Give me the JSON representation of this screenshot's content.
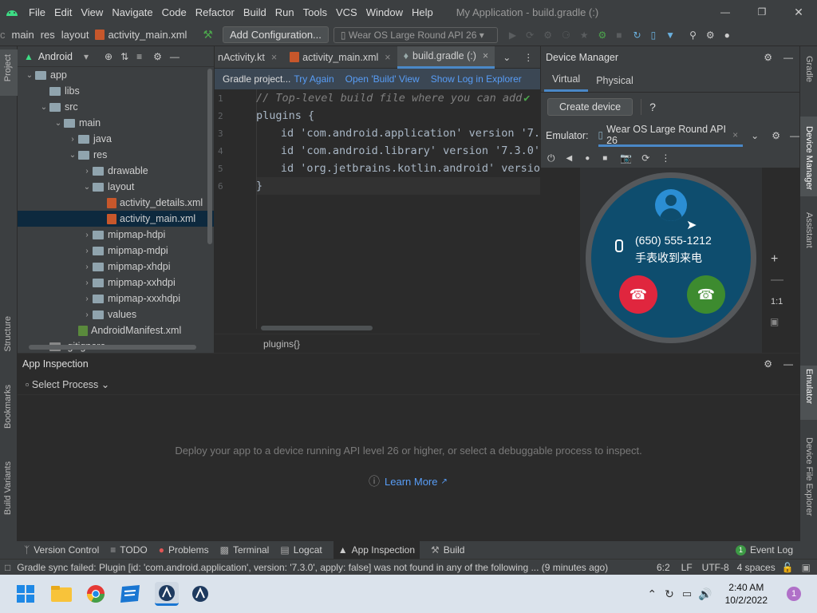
{
  "menubar": {
    "items": [
      "File",
      "Edit",
      "View",
      "Navigate",
      "Code",
      "Refactor",
      "Build",
      "Run",
      "Tools",
      "VCS",
      "Window",
      "Help"
    ],
    "title": "My Application - build.gradle (:)"
  },
  "navbar": {
    "breadcrumbs": [
      "main",
      "res",
      "layout",
      "activity_main.xml"
    ],
    "add_config": "Add Configuration...",
    "device": "Wear OS Large Round API 26"
  },
  "left_stripe": [
    "Project",
    "Structure",
    "Bookmarks",
    "Build Variants"
  ],
  "right_stripe": [
    "Gradle",
    "Device Manager",
    "Assistant",
    "Emulator",
    "Device File Explorer"
  ],
  "project": {
    "view": "Android",
    "tree": [
      {
        "label": "app",
        "depth": 0,
        "arrow": "v",
        "kind": "folder"
      },
      {
        "label": "libs",
        "depth": 1,
        "arrow": "",
        "kind": "folder"
      },
      {
        "label": "src",
        "depth": 1,
        "arrow": "v",
        "kind": "folder"
      },
      {
        "label": "main",
        "depth": 2,
        "arrow": "v",
        "kind": "folder"
      },
      {
        "label": "java",
        "depth": 3,
        "arrow": ">",
        "kind": "folder"
      },
      {
        "label": "res",
        "depth": 3,
        "arrow": "v",
        "kind": "folder"
      },
      {
        "label": "drawable",
        "depth": 4,
        "arrow": ">",
        "kind": "folder"
      },
      {
        "label": "layout",
        "depth": 4,
        "arrow": "v",
        "kind": "folder"
      },
      {
        "label": "activity_details.xml",
        "depth": 5,
        "arrow": "",
        "kind": "xml"
      },
      {
        "label": "activity_main.xml",
        "depth": 5,
        "arrow": "",
        "kind": "xml",
        "selected": true
      },
      {
        "label": "mipmap-hdpi",
        "depth": 4,
        "arrow": ">",
        "kind": "folder"
      },
      {
        "label": "mipmap-mdpi",
        "depth": 4,
        "arrow": ">",
        "kind": "folder"
      },
      {
        "label": "mipmap-xhdpi",
        "depth": 4,
        "arrow": ">",
        "kind": "folder"
      },
      {
        "label": "mipmap-xxhdpi",
        "depth": 4,
        "arrow": ">",
        "kind": "folder"
      },
      {
        "label": "mipmap-xxxhdpi",
        "depth": 4,
        "arrow": ">",
        "kind": "folder"
      },
      {
        "label": "values",
        "depth": 4,
        "arrow": ">",
        "kind": "folder"
      },
      {
        "label": "AndroidManifest.xml",
        "depth": 3,
        "arrow": "",
        "kind": "manifest"
      },
      {
        "label": ".gitignore",
        "depth": 1,
        "arrow": "",
        "kind": "file"
      }
    ]
  },
  "editor": {
    "tabs": [
      "nActivity.kt",
      "activity_main.xml",
      "build.gradle (:)"
    ],
    "gradle_bar": {
      "message": "Gradle project...",
      "try_again": "Try Again",
      "open_build": "Open 'Build' View",
      "show_log": "Show Log in Explorer"
    },
    "lines": [
      {
        "n": "1",
        "code": "// Top-level build file where you can add"
      },
      {
        "n": "2",
        "code": "plugins {"
      },
      {
        "n": "3",
        "code": "    id 'com.android.application' version '7."
      },
      {
        "n": "4",
        "code": "    id 'com.android.library' version '7.3.0'"
      },
      {
        "n": "5",
        "code": "    id 'org.jetbrains.kotlin.android' versio"
      },
      {
        "n": "6",
        "code": "}"
      }
    ],
    "breadcrumb": "plugins{}"
  },
  "device_manager": {
    "title": "Device Manager",
    "tabs": [
      "Virtual",
      "Physical"
    ],
    "create_device": "Create device",
    "help": "?"
  },
  "emulator": {
    "label": "Emulator:",
    "device_tab": "Wear OS Large Round API 26",
    "phone_number": "(650) 555-1212",
    "call_text": "手表收到来电",
    "zoom_ratio": "1:1"
  },
  "app_inspection": {
    "title": "App Inspection",
    "select_process": "Select Process",
    "message": "Deploy your app to a device running API level 26 or higher, or select a debuggable process to inspect.",
    "learn_more": "Learn More"
  },
  "tool_windows": [
    "Version Control",
    "TODO",
    "Problems",
    "Terminal",
    "Logcat",
    "App Inspection",
    "Build"
  ],
  "event_log": {
    "badge": "1",
    "label": "Event Log"
  },
  "status": {
    "message": "Gradle sync failed: Plugin [id: 'com.android.application', version: '7.3.0', apply: false] was not found in any of the following ... (9 minutes ago)",
    "position": "6:2",
    "line_sep": "LF",
    "encoding": "UTF-8",
    "indent": "4 spaces"
  },
  "taskbar": {
    "time": "2:40 AM",
    "date": "10/2/2022",
    "notifications": "1"
  },
  "colors": {
    "accent": "#4a88c7",
    "link": "#589df6",
    "decline": "#e0263e",
    "accept": "#3d8b2f",
    "watch_bg": "#0e4d6e"
  }
}
